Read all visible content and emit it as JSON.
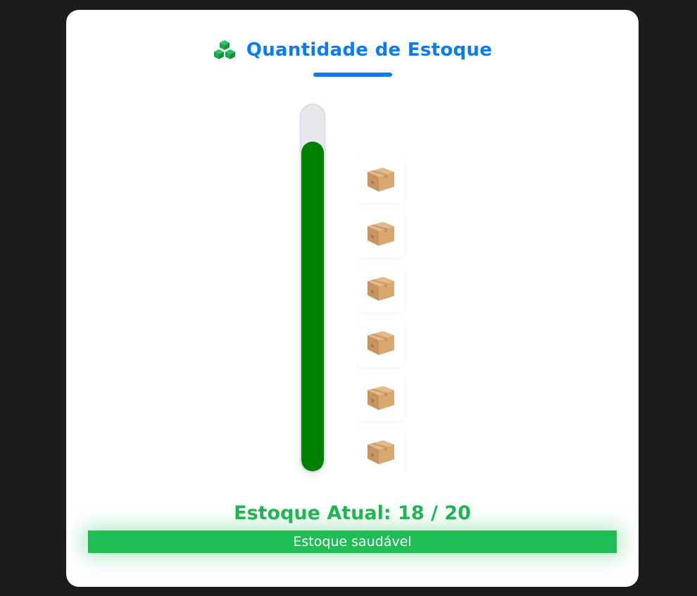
{
  "header": {
    "icon": "cubes-icon",
    "title": "Quantidade de Estoque"
  },
  "stock": {
    "current": 18,
    "max": 20,
    "level_fraction": 0.9,
    "value_text": "Estoque Atual: 18 / 20",
    "status_text": "Estoque saudável",
    "visible_box_tiles": 6,
    "box_icon": "package-box-icon"
  },
  "colors": {
    "accent": "#0a7cf2",
    "icon_green": "#1fb651",
    "gauge_fill": "#008000",
    "gauge_track": "#e6e8ee",
    "status_bg": "#1fbe55",
    "page_bg": "#1c1c1c"
  }
}
